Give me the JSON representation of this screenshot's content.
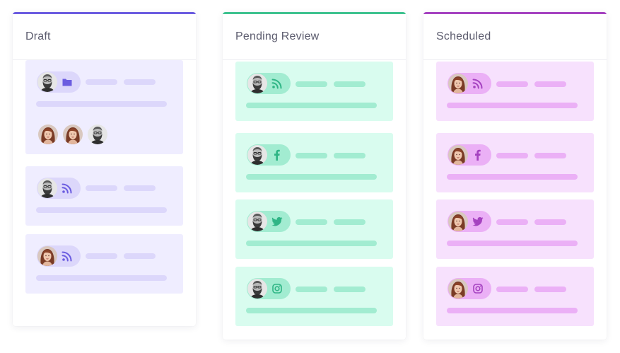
{
  "columns": [
    {
      "title": "Draft",
      "accent": "#6b5ce0",
      "card_bg": "#efedff",
      "pill_bg": "#dcd7fb",
      "bar": "#dcd7fb",
      "icon_color": "#6b5ce0",
      "cards": [
        {
          "icon": "folder-icon",
          "avatar": "man",
          "extra_avatars": [
            "woman",
            "woman",
            "man"
          ]
        },
        {
          "icon": "rss-icon",
          "avatar": "man"
        },
        {
          "icon": "rss-icon",
          "avatar": "woman"
        }
      ]
    },
    {
      "title": "Pending Review",
      "accent": "#3ec28f",
      "card_bg": "#d9fcef",
      "pill_bg": "#a2ecd1",
      "bar": "#a2ecd1",
      "icon_color": "#2fb585",
      "cards": [
        {
          "icon": "rss-icon",
          "avatar": "man"
        },
        {
          "icon": "facebook-icon",
          "avatar": "man"
        },
        {
          "icon": "twitter-icon",
          "avatar": "man"
        },
        {
          "icon": "instagram-icon",
          "avatar": "man"
        }
      ]
    },
    {
      "title": "Scheduled",
      "accent": "#a542c0",
      "card_bg": "#f7e1fd",
      "pill_bg": "#ebb0f6",
      "bar": "#ebb0f6",
      "icon_color": "#a542c0",
      "cards": [
        {
          "icon": "rss-icon",
          "avatar": "woman"
        },
        {
          "icon": "facebook-icon",
          "avatar": "woman"
        },
        {
          "icon": "twitter-icon",
          "avatar": "woman"
        },
        {
          "icon": "instagram-icon",
          "avatar": "woman"
        }
      ]
    }
  ]
}
